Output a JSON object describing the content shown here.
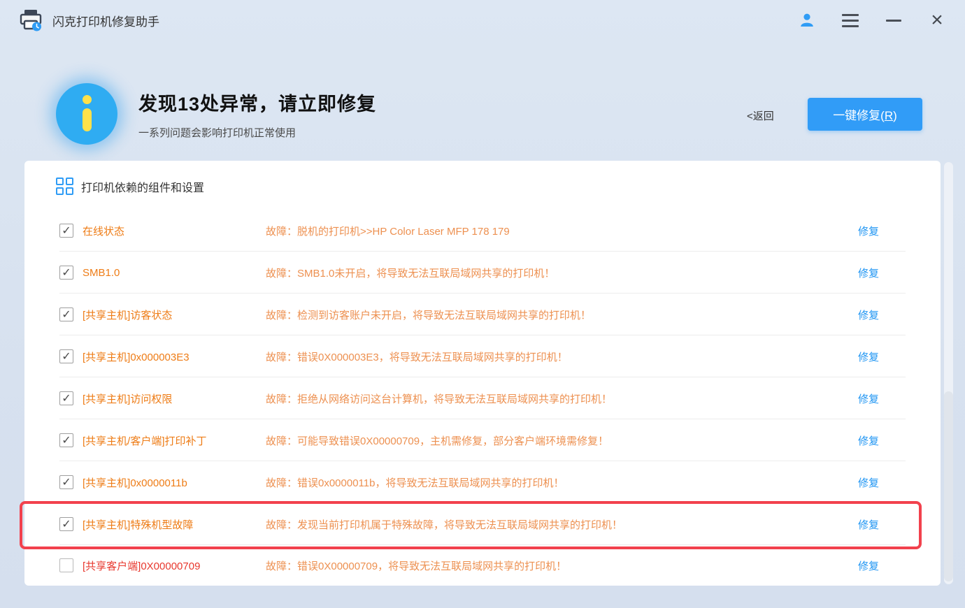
{
  "titlebar": {
    "app_title": "闪克打印机修复助手"
  },
  "header": {
    "issue_count": "13",
    "title": "发现13处异常，请立即修复",
    "subtitle": "一系列问题会影响打印机正常使用",
    "back_label": "<返回",
    "repair_button": {
      "prefix": "一键修复(",
      "key": "R",
      "suffix": ")"
    }
  },
  "panel": {
    "section_title": "打印机依赖的组件和设置",
    "fix_label": "修复",
    "rows": [
      {
        "checked": true,
        "highlighted": false,
        "label_color": "orange",
        "label": "在线状态",
        "desc": "故障：脱机的打印机>>HP Color Laser MFP 178 179"
      },
      {
        "checked": true,
        "highlighted": false,
        "label_color": "orange",
        "label": "SMB1.0",
        "desc": "故障：SMB1.0未开启，将导致无法互联局域网共享的打印机！"
      },
      {
        "checked": true,
        "highlighted": false,
        "label_color": "orange",
        "label": "[共享主机]访客状态",
        "desc": "故障：检测到访客账户未开启，将导致无法互联局域网共享的打印机！"
      },
      {
        "checked": true,
        "highlighted": false,
        "label_color": "orange",
        "label": "[共享主机]0x000003E3",
        "desc": "故障：错误0X000003E3，将导致无法互联局域网共享的打印机！"
      },
      {
        "checked": true,
        "highlighted": false,
        "label_color": "orange",
        "label": "[共享主机]访问权限",
        "desc": "故障：拒绝从网络访问这台计算机，将导致无法互联局域网共享的打印机！"
      },
      {
        "checked": true,
        "highlighted": false,
        "label_color": "orange",
        "label": "[共享主机/客户端]打印补丁",
        "desc": "故障：可能导致错误0X00000709，主机需修复，部分客户端环境需修复！"
      },
      {
        "checked": true,
        "highlighted": false,
        "label_color": "orange",
        "label": "[共享主机]0x0000011b",
        "desc": "故障：错误0x0000011b，将导致无法互联局域网共享的打印机！"
      },
      {
        "checked": true,
        "highlighted": true,
        "label_color": "orange",
        "label": "[共享主机]特殊机型故障",
        "desc": "故障：发现当前打印机属于特殊故障，将导致无法互联局域网共享的打印机！"
      },
      {
        "checked": false,
        "highlighted": false,
        "label_color": "red",
        "label": "[共享客户端]0X00000709",
        "desc": "故障：错误0X00000709，将导致无法互联局域网共享的打印机！"
      }
    ]
  },
  "icons": {
    "close_glyph": "×",
    "check_glyph": "✓"
  },
  "colors": {
    "accent_blue": "#319cf7",
    "link_blue": "#2196f3",
    "warning_orange": "#ee7c16",
    "desc_orange": "#ed9050",
    "error_red": "#e8382e",
    "highlight_border_red": "#f2414d",
    "info_badge_blue": "#2facf2",
    "info_i_yellow": "#ffe14a",
    "window_background": "#d7e1ef"
  }
}
